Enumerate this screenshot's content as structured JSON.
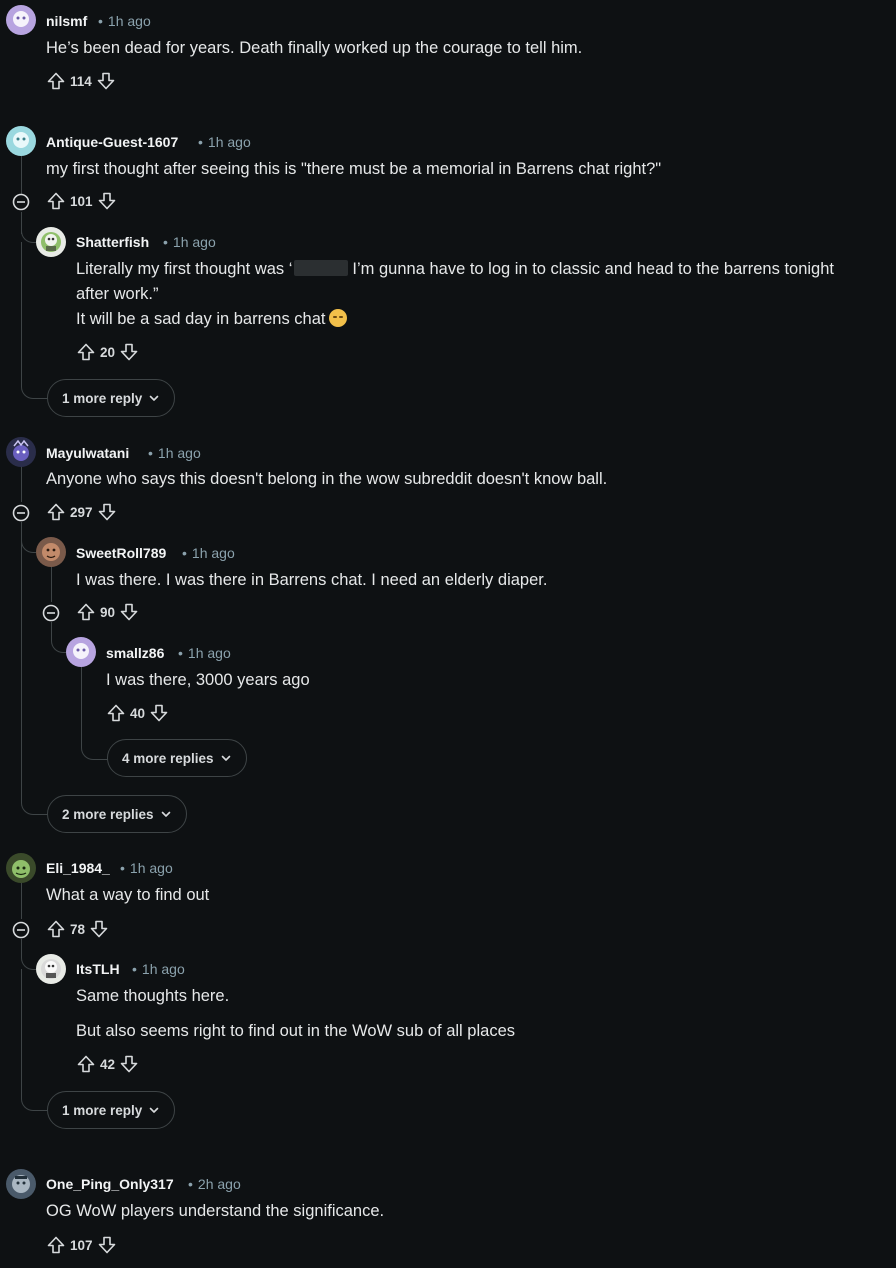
{
  "comments": [
    {
      "user": "nilsmf",
      "time": "1h ago",
      "lines": [
        "He’s been dead for years. Death finally worked up the courage to tell him."
      ],
      "votes": "114"
    },
    {
      "user": "Antique-Guest-1607",
      "time": "1h ago",
      "lines": [
        "my first thought after seeing this is \"there must be a memorial in Barrens chat right?\""
      ],
      "votes": "101"
    },
    {
      "user": "Shatterfish",
      "time": "1h ago",
      "line1_pre": "Literally my first thought was ‘",
      "line1_post": "I’m gunna have to log in to classic and head to the barrens tonight",
      "line2": "after work.”",
      "line3": "It will be a sad day in barrens chat",
      "emoji": "disappointed-face-emoji",
      "votes": "20"
    },
    {
      "user": "Mayulwatani",
      "time": "1h ago",
      "lines": [
        "Anyone who says this doesn't belong in the wow subreddit doesn't know ball."
      ],
      "votes": "297"
    },
    {
      "user": "SweetRoll789",
      "time": "1h ago",
      "lines": [
        "I was there. I was there in Barrens chat. I need an elderly diaper."
      ],
      "votes": "90"
    },
    {
      "user": "smallz86",
      "time": "1h ago",
      "lines": [
        "I was there, 3000 years ago"
      ],
      "votes": "40"
    },
    {
      "user": "Eli_1984_",
      "time": "1h ago",
      "lines": [
        "What a way to find out"
      ],
      "votes": "78"
    },
    {
      "user": "ItsTLH",
      "time": "1h ago",
      "lines": [
        "Same thoughts here.",
        "But also seems right to find out in the WoW sub of all places"
      ],
      "votes": "42"
    },
    {
      "user": "One_Ping_Only317",
      "time": "2h ago",
      "lines": [
        "OG WoW players understand the significance."
      ],
      "votes": "107"
    }
  ],
  "more_replies": {
    "shatterfish_thread": "1 more reply",
    "smallz86_thread": "4 more replies",
    "sweetroll_thread": "2 more replies",
    "itstlh_thread": "1 more reply"
  },
  "separator": "•",
  "colors": {
    "background": "#0e1113",
    "text": "#e6e8e9",
    "meta": "#8ba2ad",
    "thread_line": "#3e4446"
  }
}
